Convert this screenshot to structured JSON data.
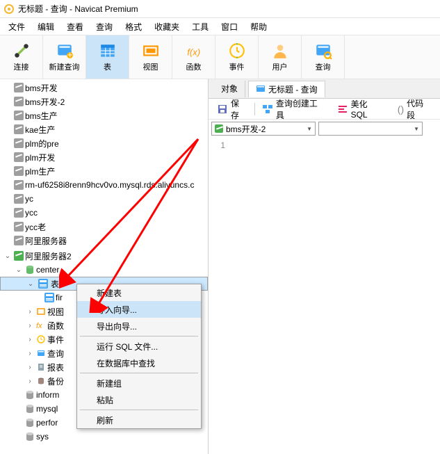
{
  "window": {
    "title": "无标题 - 查询 - Navicat Premium"
  },
  "menu": [
    "文件",
    "编辑",
    "查看",
    "查询",
    "格式",
    "收藏夹",
    "工具",
    "窗口",
    "帮助"
  ],
  "toolbar": [
    {
      "name": "connect",
      "label": "连接"
    },
    {
      "name": "new-query",
      "label": "新建查询"
    },
    {
      "name": "table",
      "label": "表",
      "active": true
    },
    {
      "name": "view",
      "label": "视图"
    },
    {
      "name": "function",
      "label": "函数"
    },
    {
      "name": "event",
      "label": "事件"
    },
    {
      "name": "user",
      "label": "用户"
    },
    {
      "name": "query",
      "label": "查询"
    }
  ],
  "connections": [
    "bms开发",
    "bms开发-2",
    "bms生产",
    "kae生产",
    "plm的pre",
    "plm开发",
    "plm生产",
    "rm-uf6258i8renn9hcv0vo.mysql.rds.aliyuncs.c",
    "yc",
    "ycc",
    "ycc老",
    "阿里服务器"
  ],
  "active_conn": {
    "name": "阿里服务器2",
    "db": "center"
  },
  "tree_groups": [
    "表",
    "视图",
    "函数",
    "事件",
    "查询",
    "报表",
    "备份"
  ],
  "tree_first_table": "fir",
  "sys_dbs": [
    "inform",
    "mysql",
    "perfor",
    "sys"
  ],
  "context_menu": [
    {
      "label": "新建表"
    },
    {
      "label": "导入向导...",
      "hl": true
    },
    {
      "label": "导出向导..."
    },
    "sep",
    {
      "label": "运行 SQL 文件..."
    },
    {
      "label": "在数据库中查找"
    },
    "sep",
    {
      "label": "新建组"
    },
    {
      "label": "粘贴"
    },
    "sep",
    {
      "label": "刷新"
    }
  ],
  "right_tabs": [
    {
      "label": "对象"
    },
    {
      "label": "无标题 - 查询",
      "icon": "query"
    }
  ],
  "query_toolbar": [
    {
      "label": "保存",
      "icon": "save"
    },
    {
      "label": "查询创建工具",
      "icon": "builder"
    },
    {
      "label": "美化 SQL",
      "icon": "beautify"
    },
    {
      "label": "代码段",
      "icon": "snippet"
    }
  ],
  "query_select": {
    "connection": "bms开发-2",
    "database": ""
  },
  "editor": {
    "line": "1"
  }
}
